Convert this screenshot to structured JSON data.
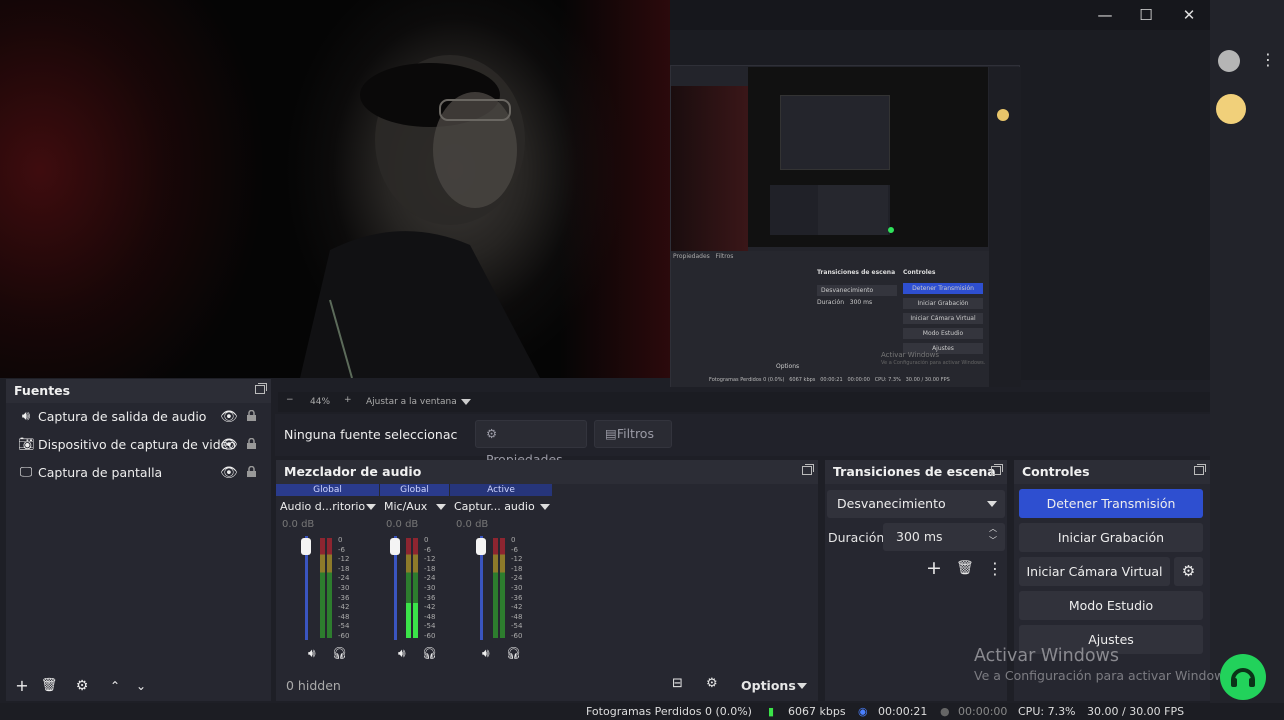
{
  "window": {
    "minimize": "—",
    "maximize": "☐",
    "close": "✕"
  },
  "nested_preview": {
    "dock_labels": [
      "Propiedades",
      "Filtros"
    ],
    "transitions_header": "Transiciones de escena",
    "controls_header": "Controles",
    "transition_combo": "Desvanecimiento",
    "duration_label": "Duración",
    "duration_value": "300 ms",
    "btn_stop": "Detener Transmisión",
    "btn_record": "Iniciar Grabación",
    "btn_vcam": "Iniciar Cámara Virtual",
    "btn_studio": "Modo Estudio",
    "btn_settings": "Ajustes",
    "watermark1": "Activar Windows",
    "watermark2": "Ve a Configuración para activar Windows.",
    "options": "Options",
    "status_dropped": "Fotogramas Perdidos 0 (0.0%)",
    "status_kbps": "6067 kbps",
    "status_time": "00:00:21",
    "status_time2": "00:00:00",
    "status_cpu": "CPU: 7.3%",
    "status_fps": "30.00 / 30.00 FPS"
  },
  "preview_toolbar": {
    "zoom_out": "−",
    "zoom": "44%",
    "zoom_in": "+",
    "fit": "Ajustar a la ventana"
  },
  "context_bar": {
    "no_source": "Ninguna fuente seleccionac",
    "properties": "Propiedades",
    "filters": "Filtros"
  },
  "sources": {
    "title": "Fuentes",
    "items": [
      {
        "label": "Captura de salida de audio",
        "icon": "speaker-icon"
      },
      {
        "label": "Dispositivo de captura de video",
        "icon": "camera-icon"
      },
      {
        "label": "Captura de pantalla",
        "icon": "monitor-icon"
      }
    ]
  },
  "mixer": {
    "title": "Mezclador de audio",
    "channels": [
      {
        "tag": "Global",
        "name": "Audio d...ritorio",
        "db": "0.0 dB",
        "level": 0.0
      },
      {
        "tag": "Global",
        "name": "Mic/Aux",
        "db": "0.0 dB",
        "level": 0.35
      },
      {
        "tag": "Active",
        "name": "Captur... audio",
        "db": "0.0 dB",
        "level": 0.0
      }
    ],
    "ticks": [
      "0",
      "-6",
      "-12",
      "-18",
      "-24",
      "-30",
      "-36",
      "-42",
      "-48",
      "-54",
      "-60"
    ],
    "hidden": "0 hidden",
    "options": "Options"
  },
  "transitions": {
    "title": "Transiciones de escena",
    "selected": "Desvanecimiento",
    "duration_label": "Duración",
    "duration_value": "300 ms"
  },
  "controls": {
    "title": "Controles",
    "stop_stream": "Detener Transmisión",
    "start_recording": "Iniciar Grabación",
    "start_vcam": "Iniciar Cámara Virtual",
    "studio_mode": "Modo Estudio",
    "settings": "Ajustes"
  },
  "watermark": {
    "line1": "Activar Windows",
    "line2": "Ve a Configuración para activar Windows."
  },
  "status": {
    "dropped": "Fotogramas Perdidos 0 (0.0%)",
    "kbps": "6067 kbps",
    "stream_time": "00:00:21",
    "rec_time": "00:00:00",
    "cpu": "CPU: 7.3%",
    "fps": "30.00 / 30.00 FPS"
  },
  "colors": {
    "accent": "#2e4fd0",
    "live_green": "#22d25b"
  }
}
